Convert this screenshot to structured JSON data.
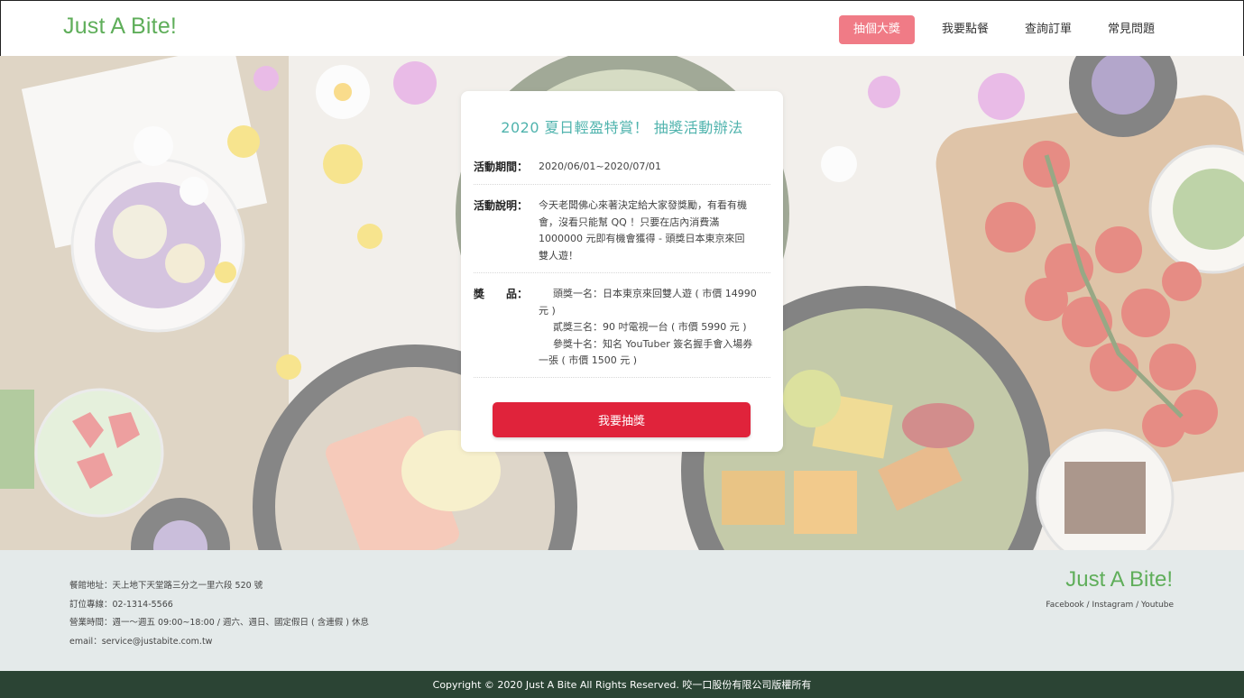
{
  "header": {
    "logo": "Just A Bite!",
    "nav": [
      {
        "label": "抽個大獎",
        "active": true
      },
      {
        "label": "我要點餐",
        "active": false
      },
      {
        "label": "查詢訂單",
        "active": false
      },
      {
        "label": "常見問題",
        "active": false
      }
    ]
  },
  "card": {
    "title": "2020 夏日輕盈特賞！ 抽獎活動辦法",
    "period_label": "活動期間：",
    "period_value": "2020/06/01~2020/07/01",
    "desc_label": "活動說明：",
    "desc_value": "今天老闆佛心來著決定給大家發獎勵，有看有機會，沒看只能幫 QQ ！只要在店內消費滿 1000000 元即有機會獲得 - 頭獎日本東京來回雙人遊！",
    "prize_label": "獎　　品：",
    "prizes": [
      "頭獎一名：日本東京來回雙人遊 ( 市價 14990 元 )",
      "貳獎三名：90 吋電視一台 ( 市價 5990 元 )",
      "參獎十名：知名 YouTuber 簽名握手會入場券一張 ( 市價 1500 元 )"
    ],
    "button_label": "我要抽獎"
  },
  "footer": {
    "address": "餐館地址：天上地下天堂路三分之一里六段 520 號",
    "phone": "訂位專線：02-1314-5566",
    "hours": "營業時間：週一～週五 09:00~18:00 / 週六、週日、國定假日 ( 含連假 ) 休息",
    "email": "email：service@justabite.com.tw",
    "logo": "Just A Bite!",
    "social": "Facebook / Instagram / Youtube",
    "copyright": "Copyright © 2020 Just A Bite All Rights Reserved. 咬一口股份有限公司版權所有"
  },
  "colors": {
    "brand_green": "#5fae5a",
    "nav_active": "#f07b86",
    "title_teal": "#4fb3ad",
    "button_red": "#e0233b",
    "footer_bg": "#e4eaea",
    "copyright_bg": "#2b4434"
  }
}
